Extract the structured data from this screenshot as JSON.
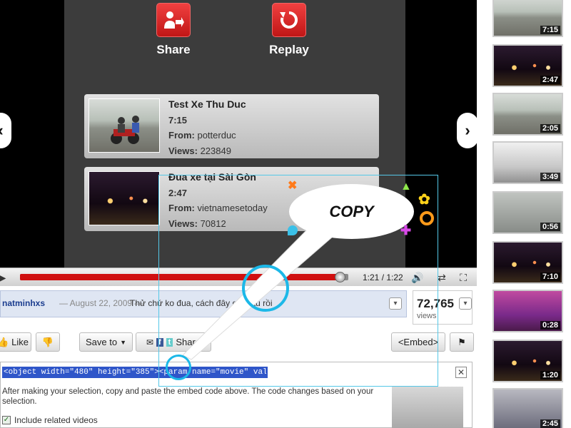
{
  "end_screen": {
    "share_label": "Share",
    "replay_label": "Replay"
  },
  "related": [
    {
      "title": "Test Xe Thu Duc",
      "duration": "7:15",
      "from_label": "From:",
      "from": "potterduc",
      "views_label": "Views:",
      "views": "223849"
    },
    {
      "title": "Đua xe tại Sài Gòn",
      "duration": "2:47",
      "from_label": "From:",
      "from": "vietnamesetoday",
      "views_label": "Views:",
      "views": "70812"
    }
  ],
  "player": {
    "time": "1:21 / 1:22",
    "progress": 0.975
  },
  "info": {
    "uploader": "natminhxs",
    "date": "— August 22, 2009 —",
    "description": "Thử chứ ko đua, cách đây quá lâu rồi",
    "views": "72,765",
    "views_label": "views"
  },
  "actions": {
    "like": "Like",
    "save": "Save to",
    "share": "Share",
    "embed": "<Embed>"
  },
  "embed": {
    "code": "<object width=\"480\" height=\"385\"><param name=\"movie\" value=",
    "help": "After making your selection, copy and paste the embed code above. The code changes based on your selection.",
    "include_related": "Include related videos"
  },
  "overlay": {
    "copy": "COPY"
  },
  "sidebar": [
    {
      "duration": "7:15"
    },
    {
      "duration": "2:47"
    },
    {
      "duration": "2:05"
    },
    {
      "duration": "3:49"
    },
    {
      "duration": "0:56"
    },
    {
      "duration": "7:10"
    },
    {
      "duration": "0:28"
    },
    {
      "duration": "1:20"
    },
    {
      "duration": "2:45"
    }
  ],
  "colors": {
    "accent_red": "#d01010",
    "link_blue": "#1b3d8f",
    "callout_cyan": "#1cb8e8"
  }
}
